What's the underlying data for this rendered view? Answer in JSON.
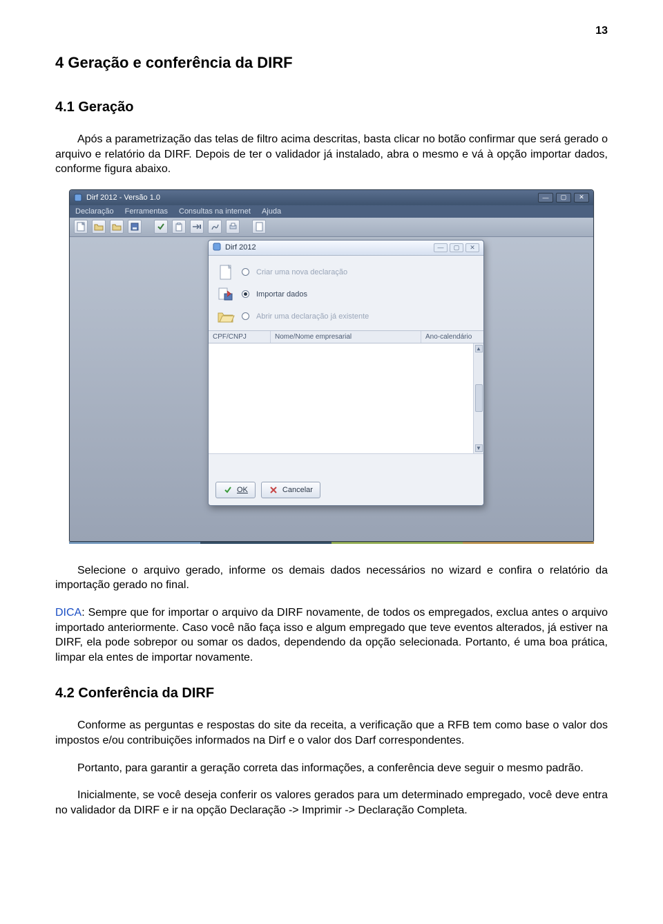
{
  "page_number": "13",
  "section_4_heading": "4   Geração e conferência da DIRF",
  "section_41_heading": "4.1   Geração",
  "para_41": "Após a parametrização das telas de filtro acima descritas, basta clicar no botão confirmar que será gerado o arquivo e relatório da DIRF. Depois de ter o validador já instalado, abra o mesmo e vá à opção importar dados, conforme figura abaixo.",
  "para_after_img": "Selecione o arquivo gerado, informe os demais dados necessários no wizard e confira o relatório da importação gerado no final.",
  "tip_label": "DICA",
  "tip_text": ": Sempre que for importar o arquivo da DIRF novamente, de todos os empregados, exclua antes o arquivo importado anteriormente. Caso você não faça isso e algum empregado que teve eventos alterados, já estiver na DIRF, ela pode sobrepor ou somar os dados, dependendo da opção selecionada. Portanto, é uma boa prática, limpar ela entes de importar novamente.",
  "section_42_heading": "4.2   Conferência da DIRF",
  "para_42a": "Conforme as perguntas e respostas do site da receita, a verificação que a RFB tem como base o valor dos impostos e/ou contribuições informados na Dirf e o valor dos Darf correspondentes.",
  "para_42b": "Portanto, para garantir a geração correta das informações, a conferência deve seguir o mesmo padrão.",
  "para_42c": "Inicialmente, se você deseja conferir os valores gerados para um determinado empregado, você deve entra no validador da DIRF e ir na opção Declaração -> Imprimir -> Declaração Completa.",
  "app": {
    "title": "Dirf 2012 - Versão 1.0",
    "menu": {
      "m1": "Declaração",
      "m2": "Ferramentas",
      "m3": "Consultas na internet",
      "m4": "Ajuda"
    }
  },
  "dialog": {
    "title": "Dirf 2012",
    "opt_create": "Criar uma nova declaração",
    "opt_import": "Importar dados",
    "opt_open": "Abrir uma declaração já existente",
    "col1": "CPF/CNPJ",
    "col2": "Nome/Nome empresarial",
    "col3": "Ano-calendário",
    "ok": "OK",
    "cancel": "Cancelar"
  }
}
